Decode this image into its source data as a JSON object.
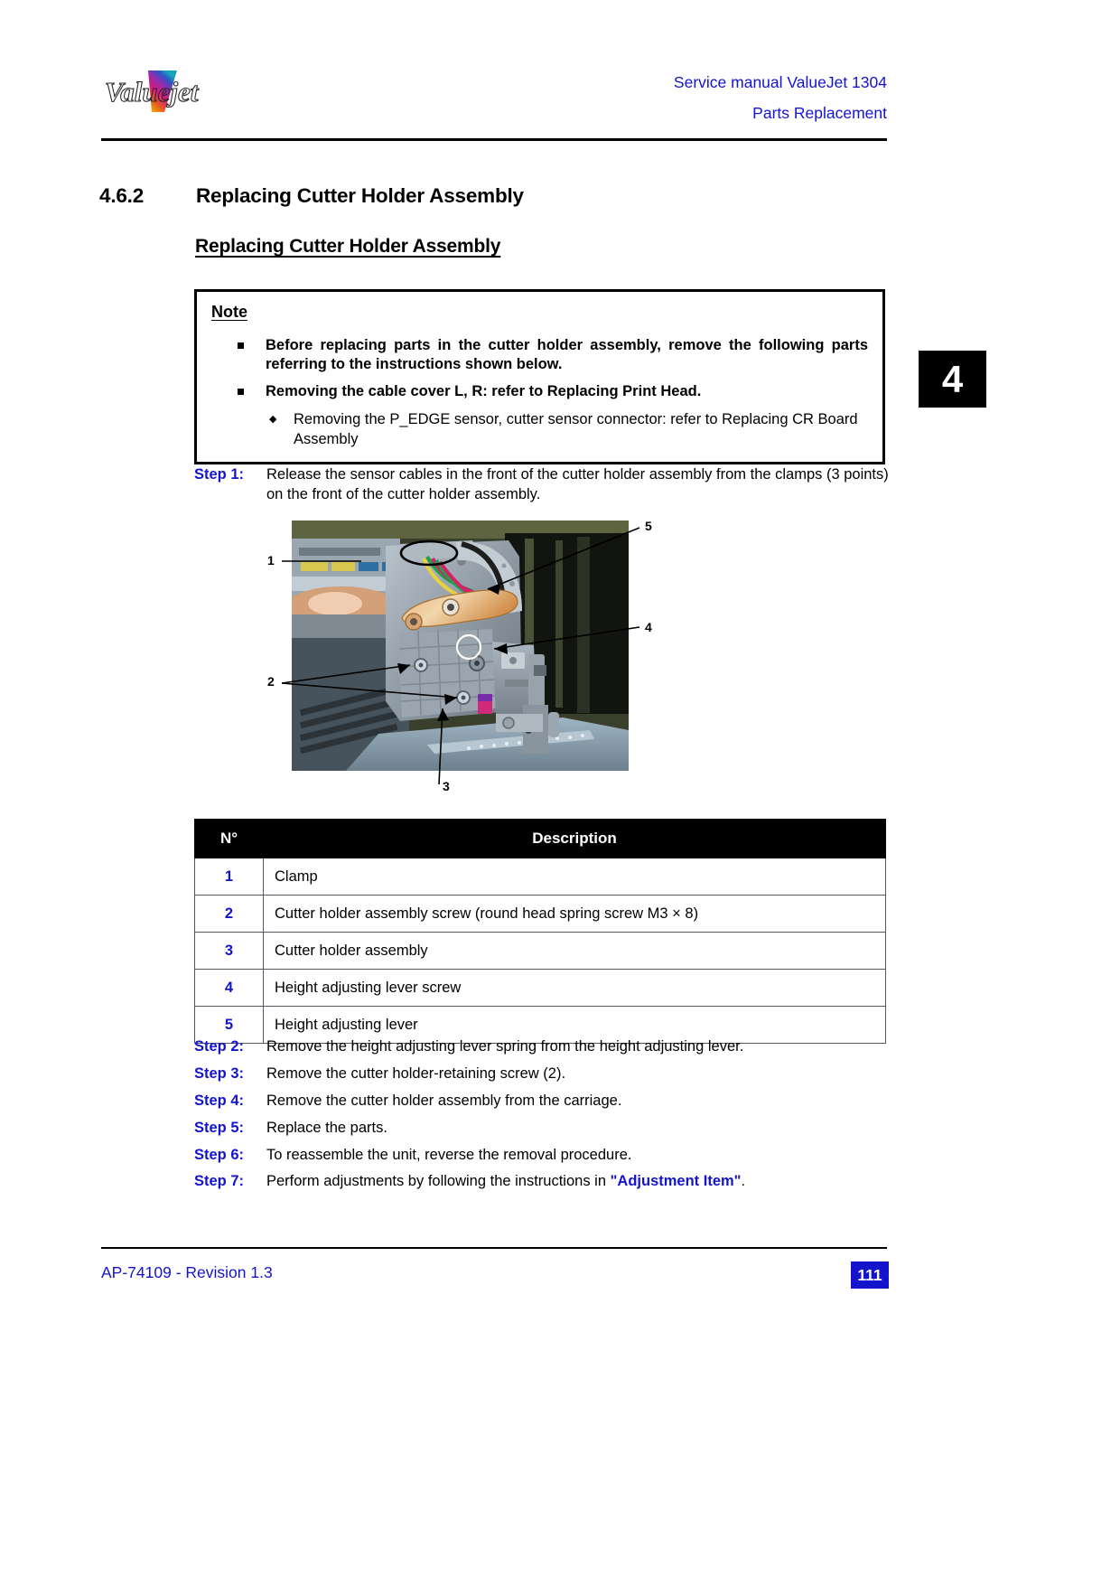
{
  "header": {
    "logo_text": "ValueJet",
    "manual_title": "Service manual ValueJet 1304",
    "chapter_title": "Parts Replacement"
  },
  "chapter_tab": {
    "number": "4"
  },
  "section": {
    "number": "4.6.2",
    "title": "Replacing Cutter Holder Assembly",
    "subtitle": "Replacing Cutter Holder Assembly"
  },
  "note": {
    "title": "Note",
    "bullets": [
      "Before replacing parts in the cutter holder assembly, remove the following parts referring to the instructions shown below.",
      "Removing the cable cover L, R: refer to Replacing Print Head."
    ],
    "subbullet": "Removing the P_EDGE sensor, cutter sensor connector: refer to Replacing CR Board Assembly"
  },
  "steps": [
    {
      "label": "Step 1:",
      "text": "Release the sensor cables in the front of the cutter holder assembly from the clamps (3 points) on the front of the cutter holder assembly."
    },
    {
      "label": "Step 2:",
      "text": "Remove the height adjusting lever spring from the height adjusting lever."
    },
    {
      "label": "Step 3:",
      "text": "Remove the cutter holder-retaining screw (2)."
    },
    {
      "label": "Step 4:",
      "text": "Remove the cutter holder assembly from the carriage."
    },
    {
      "label": "Step 5:",
      "text": "Replace the parts."
    },
    {
      "label": "Step 6:",
      "text": "To reassemble the unit, reverse the removal procedure."
    },
    {
      "label": "Step 7:",
      "text_before": "Perform adjustments by following the instructions in ",
      "link": "\"Adjustment Item\"",
      "text_after": "."
    }
  ],
  "figure": {
    "callouts": [
      "1",
      "2",
      "3",
      "4",
      "5"
    ],
    "caption": ""
  },
  "table": {
    "headers": [
      "N°",
      "Description"
    ],
    "rows": [
      {
        "num": "1",
        "desc": "Clamp"
      },
      {
        "num": "2",
        "desc": "Cutter holder assembly screw (round head spring screw M3 × 8)"
      },
      {
        "num": "3",
        "desc": "Cutter holder assembly"
      },
      {
        "num": "4",
        "desc": "Height adjusting lever screw"
      },
      {
        "num": "5",
        "desc": "Height adjusting lever"
      }
    ]
  },
  "footer": {
    "document_id": "AP-74109 - Revision 1.3",
    "page": "111"
  },
  "colors": {
    "accent_blue": "#1414CD",
    "table_header_bg": "#000000"
  }
}
